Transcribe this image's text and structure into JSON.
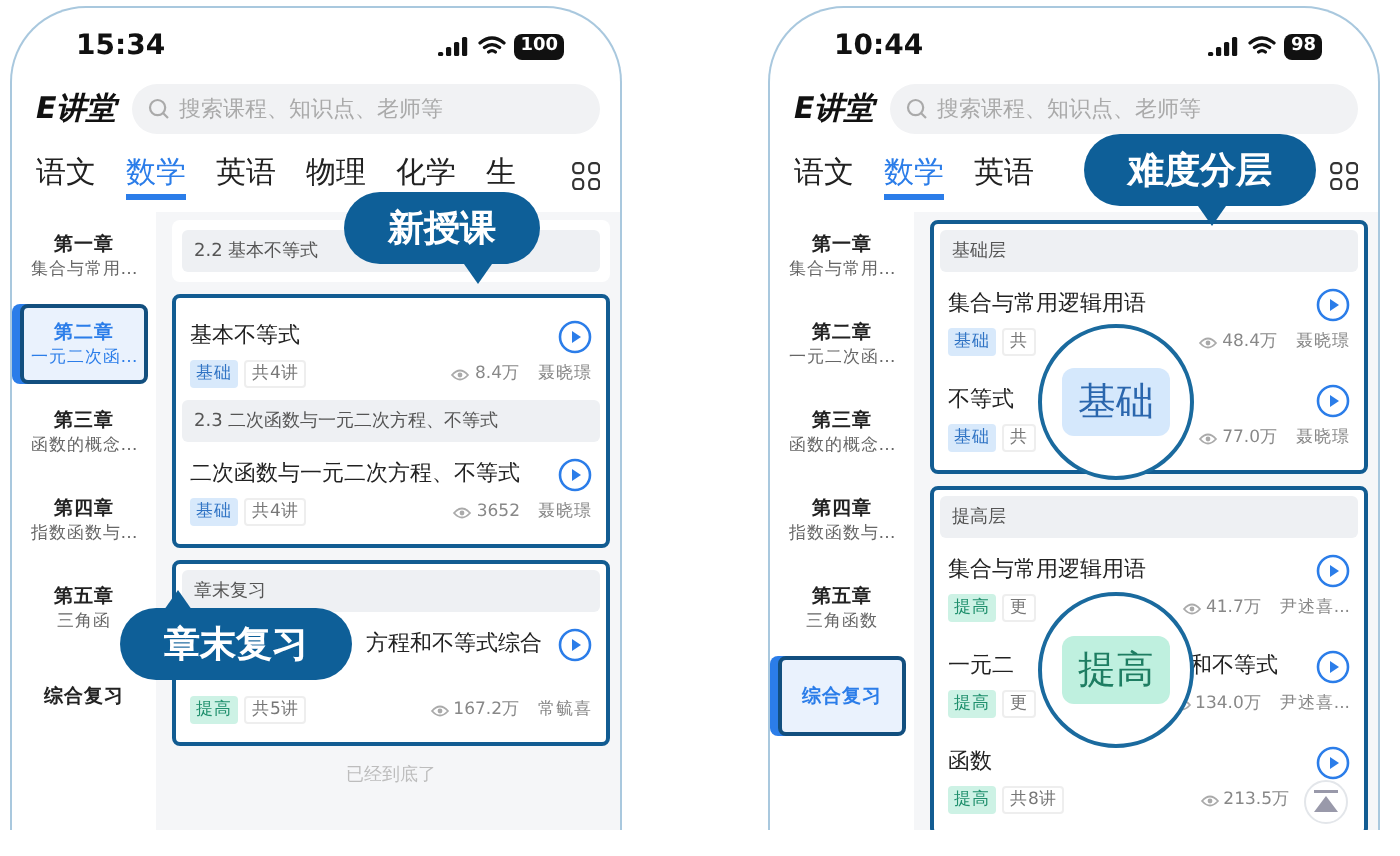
{
  "phones": [
    {
      "status_bar": {
        "time": "15:34",
        "battery": "100"
      },
      "logo": "E讲堂",
      "search": {
        "placeholder": "搜索课程、知识点、老师等"
      },
      "tabs": [
        {
          "label": "语文",
          "selected": false
        },
        {
          "label": "数学",
          "selected": true
        },
        {
          "label": "英语",
          "selected": false
        },
        {
          "label": "物理",
          "selected": false
        },
        {
          "label": "化学",
          "selected": false
        },
        {
          "label": "生",
          "selected": false
        }
      ],
      "chapters": [
        {
          "title": "第一章",
          "subtitle": "集合与常用…",
          "selected": false
        },
        {
          "title": "第二章",
          "subtitle": "一元二次函…",
          "selected": true
        },
        {
          "title": "第三章",
          "subtitle": "函数的概念…",
          "selected": false
        },
        {
          "title": "第四章",
          "subtitle": "指数函数与…",
          "selected": false
        },
        {
          "title": "第五章",
          "subtitle": "三角函",
          "selected": false
        },
        {
          "title": "综合复习",
          "selected": false
        }
      ],
      "groups": [
        {
          "highlighted": false,
          "items": [
            {
              "kind": "section",
              "label": "2.2 基本不等式"
            }
          ]
        },
        {
          "highlighted": true,
          "items": [
            {
              "kind": "course",
              "title": "基本不等式",
              "tag": "基础",
              "color": "#d8e9fb",
              "count": "共4讲",
              "views": "8.4万",
              "teacher": "聂晓璟"
            },
            {
              "kind": "section",
              "label": "2.3 二次函数与一元二次方程、不等式"
            },
            {
              "kind": "course",
              "title": "二次函数与一元二次方程、不等式",
              "tag": "基础",
              "color": "#d8e9fb",
              "count": "共4讲",
              "views": "3652",
              "teacher": "聂晓璟"
            }
          ]
        },
        {
          "highlighted": true,
          "items": [
            {
              "kind": "section",
              "label": "章末复习"
            },
            {
              "kind": "course",
              "title": "方程和不等式综合",
              "tag": "提高",
              "color": "#cdf2e5",
              "count": "共5讲",
              "views": "167.2万",
              "teacher": "常毓喜"
            }
          ]
        }
      ],
      "footer": "已经到底了",
      "callouts": [
        {
          "kind": "bubble",
          "text": "新授课"
        },
        {
          "kind": "bubble",
          "text": "章末复习"
        }
      ]
    },
    {
      "status_bar": {
        "time": "10:44",
        "battery": "98"
      },
      "logo": "E讲堂",
      "search": {
        "placeholder": "搜索课程、知识点、老师等"
      },
      "tabs": [
        {
          "label": "语文",
          "selected": false
        },
        {
          "label": "数学",
          "selected": true
        },
        {
          "label": "英语",
          "selected": false
        }
      ],
      "chapters": [
        {
          "title": "第一章",
          "subtitle": "集合与常用…",
          "selected": false
        },
        {
          "title": "第二章",
          "subtitle": "一元二次函…",
          "selected": false
        },
        {
          "title": "第三章",
          "subtitle": "函数的概念…",
          "selected": false
        },
        {
          "title": "第四章",
          "subtitle": "指数函数与…",
          "selected": false
        },
        {
          "title": "第五章",
          "subtitle": "三角函数",
          "selected": false
        },
        {
          "title": "综合复习",
          "selected": true
        }
      ],
      "groups": [
        {
          "highlighted": true,
          "items": [
            {
              "kind": "section",
              "label": "基础层"
            },
            {
              "kind": "course",
              "title": "集合与常用逻辑用语",
              "tag": "基础",
              "color": "#d8e9fb",
              "count": "共",
              "views": "48.4万",
              "teacher": "聂晓璟"
            },
            {
              "kind": "course",
              "title": "不等式",
              "tag": "基础",
              "color": "#d8e9fb",
              "count": "共",
              "views": "77.0万",
              "teacher": "聂晓璟"
            }
          ]
        },
        {
          "highlighted": true,
          "items": [
            {
              "kind": "section",
              "label": "提高层"
            },
            {
              "kind": "course",
              "title": "集合与常用逻辑用语",
              "tag": "提高",
              "color": "#cdf2e5",
              "count": "更",
              "views": "41.7万",
              "teacher": "尹述喜..."
            },
            {
              "kind": "course",
              "title": "一元二",
              "title_after": "和不等式",
              "tag": "提高",
              "color": "#cdf2e5",
              "count": "更",
              "views": "134.0万",
              "teacher": "尹述喜..."
            },
            {
              "kind": "course",
              "title": "函数",
              "tag": "提高",
              "color": "#cdf2e5",
              "count": "共8讲",
              "views": "213.5万"
            }
          ]
        }
      ],
      "scroll_top": true,
      "callouts": [
        {
          "kind": "bubble",
          "text": "难度分层"
        },
        {
          "kind": "magnifier",
          "text": "基础",
          "color": "#d5e8fc"
        },
        {
          "kind": "magnifier",
          "text": "提高",
          "color": "#bff0df"
        }
      ]
    }
  ]
}
